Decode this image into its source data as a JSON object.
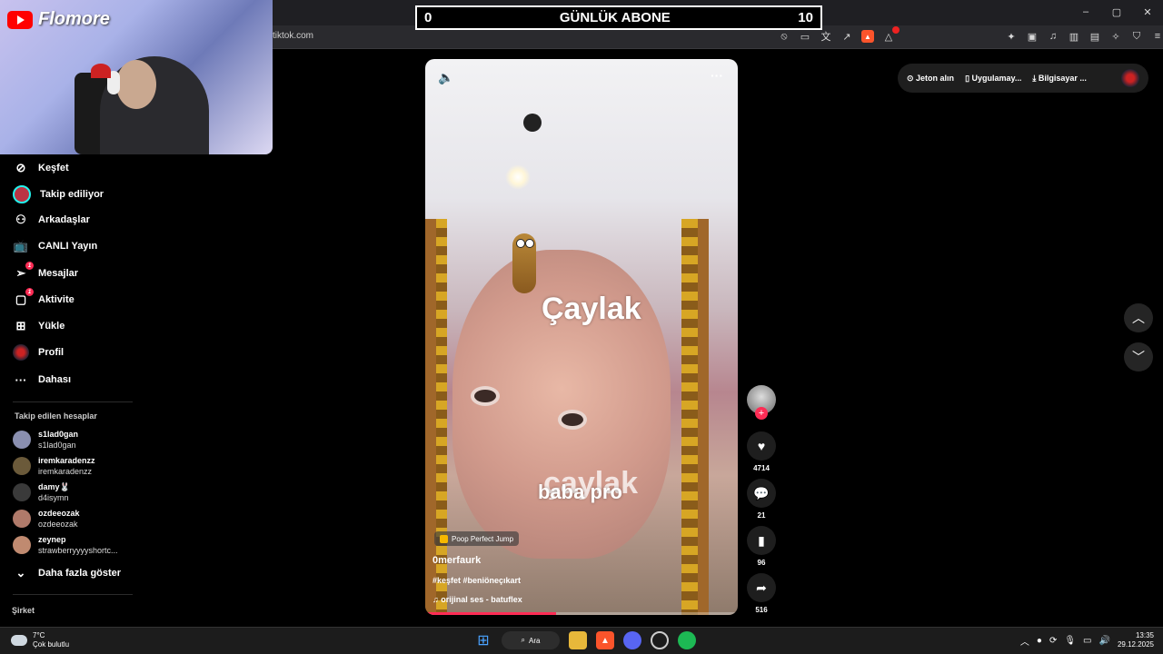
{
  "browser": {
    "url": "tiktok.com",
    "window_controls": [
      "–",
      "▢",
      "✕"
    ]
  },
  "overlay": {
    "channel_name": "Flomore",
    "sub_counter": {
      "left": "0",
      "title": "GÜNLÜK ABONE",
      "right": "10"
    }
  },
  "nav": {
    "items": [
      {
        "label": "Keşfet",
        "icon": "compass-icon"
      },
      {
        "label": "Takip ediliyor",
        "icon": "following-avatar"
      },
      {
        "label": "Arkadaşlar",
        "icon": "friends-icon"
      },
      {
        "label": "CANLI Yayın",
        "icon": "live-icon"
      },
      {
        "label": "Mesajlar",
        "icon": "messages-icon",
        "badge": "1"
      },
      {
        "label": "Aktivite",
        "icon": "activity-icon",
        "badge": "1"
      },
      {
        "label": "Yükle",
        "icon": "upload-icon"
      },
      {
        "label": "Profil",
        "icon": "profile-avatar"
      },
      {
        "label": "Dahası",
        "icon": "more-icon"
      }
    ],
    "following_title": "Takip edilen hesaplar",
    "following": [
      {
        "username": "s1lad0gan",
        "display": "s1lad0gan",
        "color": "#8a8fb0"
      },
      {
        "username": "iremkaradenzz",
        "display": "iremkaradenzz",
        "color": "#6b5a3a"
      },
      {
        "username": "damy🐰",
        "display": "d4isymn",
        "color": "#3a3a3a"
      },
      {
        "username": "ozdeeozak",
        "display": "ozdeeozak",
        "color": "#b07a6a"
      },
      {
        "username": "zeynep",
        "display": "strawberryyyyshortc...",
        "color": "#c08a70"
      }
    ],
    "show_more": "Daha fazla göster",
    "company": "Şirket"
  },
  "video": {
    "overlay_text_1": "Çaylak",
    "overlay_text_2": "çaylak",
    "overlay_text_3": "baba pro",
    "game_tag": "Poop Perfect Jump",
    "author": "0merfaurk",
    "hashtags": "#keşfet #beniöneçıkart",
    "sound": "orijinal ses - batuflex",
    "progress": 0.42
  },
  "actions": {
    "likes": "4714",
    "comments": "21",
    "saves": "96",
    "shares": "516"
  },
  "top_right": {
    "coins": "Jeton alın",
    "app": "Uygulamay...",
    "desktop": "Bilgisayar ..."
  },
  "taskbar": {
    "temp": "7°C",
    "weather": "Çok bulutlu",
    "search": "Ara",
    "time": "13:35",
    "date": "29.12.2025"
  }
}
